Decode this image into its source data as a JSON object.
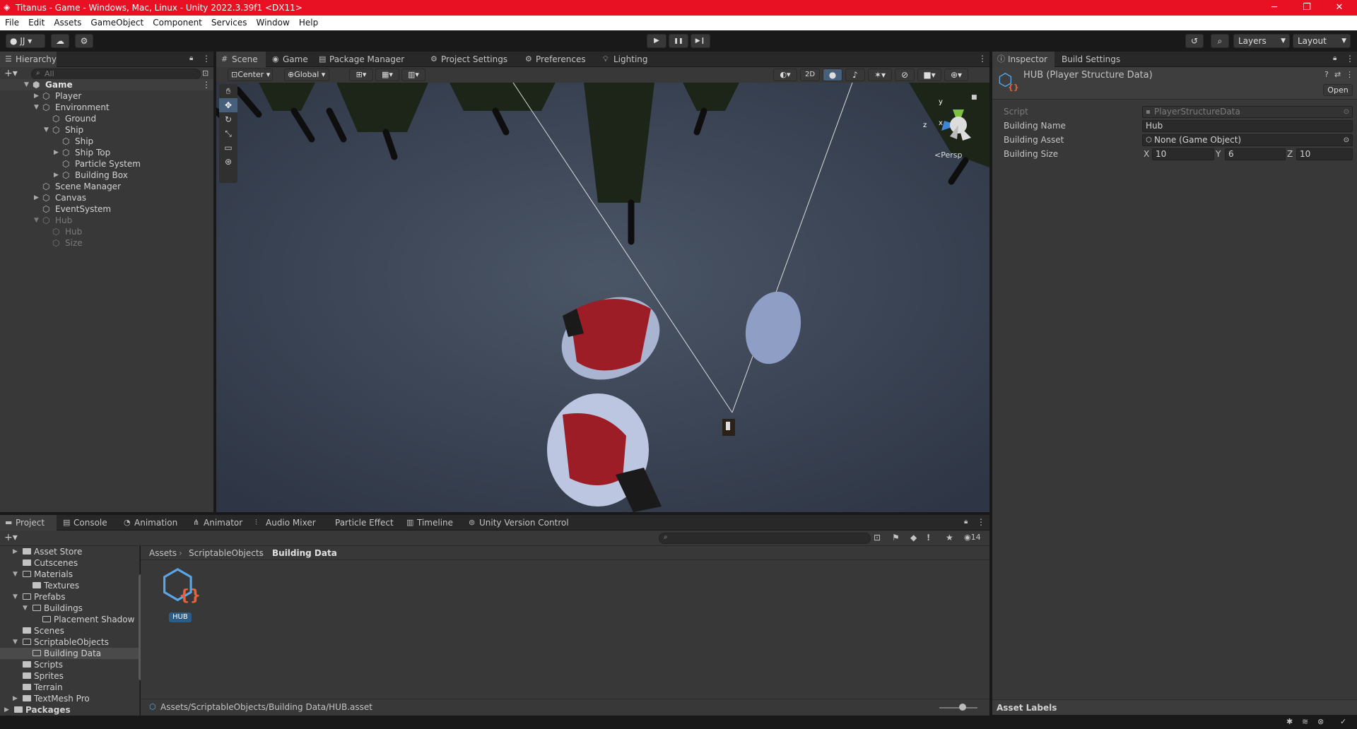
{
  "titlebar": {
    "title": "Titanus - Game - Windows, Mac, Linux - Unity 2022.3.39f1 <DX11>",
    "minimize": "─",
    "maximize": "❐",
    "close": "✕"
  },
  "menubar": [
    "File",
    "Edit",
    "Assets",
    "GameObject",
    "Component",
    "Services",
    "Window",
    "Help"
  ],
  "toolbar": {
    "account": "JJ",
    "layers": "Layers",
    "layout": "Layout",
    "play": "▶",
    "pause": "❚❚",
    "step": "▶❙"
  },
  "hierarchy": {
    "tab": "Hierarchy",
    "search_placeholder": "All",
    "items": [
      {
        "label": "Game",
        "arrow": "▼"
      },
      {
        "label": "Player",
        "arrow": "▶"
      },
      {
        "label": "Environment",
        "arrow": "▼"
      },
      {
        "label": "Ground",
        "arrow": ""
      },
      {
        "label": "Ship",
        "arrow": "▼"
      },
      {
        "label": "Ship",
        "arrow": ""
      },
      {
        "label": "Ship Top",
        "arrow": "▶"
      },
      {
        "label": "Particle System",
        "arrow": ""
      },
      {
        "label": "Building Box",
        "arrow": "▶"
      },
      {
        "label": "Scene Manager",
        "arrow": ""
      },
      {
        "label": "Canvas",
        "arrow": "▶"
      },
      {
        "label": "EventSystem",
        "arrow": ""
      },
      {
        "label": "Hub",
        "arrow": "▼"
      },
      {
        "label": "Hub",
        "arrow": ""
      },
      {
        "label": "Size",
        "arrow": ""
      }
    ]
  },
  "scene_tabs": [
    "Scene",
    "Game",
    "Package Manager",
    "Project Settings",
    "Preferences",
    "Lighting"
  ],
  "scene_toolbar": {
    "pivot": "Center",
    "space": "Global",
    "mode2d": "2D",
    "persp": "Persp",
    "axis_x": "x",
    "axis_y": "y",
    "axis_z": "z"
  },
  "inspector": {
    "tabs": [
      "Inspector",
      "Build Settings"
    ],
    "header": "HUB (Player Structure Data)",
    "open_label": "Open",
    "fields": {
      "script_label": "Script",
      "script_value": "PlayerStructureData",
      "name_label": "Building Name",
      "name_value": "Hub",
      "asset_label": "Building Asset",
      "asset_value": "None (Game Object)",
      "size_label": "Building Size",
      "x_label": "X",
      "x_value": "10",
      "y_label": "Y",
      "y_value": "6",
      "z_label": "Z",
      "z_value": "10"
    },
    "asset_labels": "Asset Labels"
  },
  "bottom_tabs": [
    "Project",
    "Console",
    "Animation",
    "Animator",
    "Audio Mixer",
    "Particle Effect",
    "Timeline",
    "Unity Version Control"
  ],
  "project": {
    "hidden_count": "14",
    "tree": [
      "Asset Store",
      "Cutscenes",
      "Materials",
      "Textures",
      "Prefabs",
      "Buildings",
      "Placement Shadow",
      "Scenes",
      "ScriptableObjects",
      "Building Data",
      "Scripts",
      "Sprites",
      "Terrain",
      "TextMesh Pro",
      "Packages"
    ],
    "breadcrumb": [
      "Assets",
      "ScriptableObjects",
      "Building Data"
    ],
    "asset_name": "HUB",
    "path": "Assets/ScriptableObjects/Building Data/HUB.asset"
  }
}
